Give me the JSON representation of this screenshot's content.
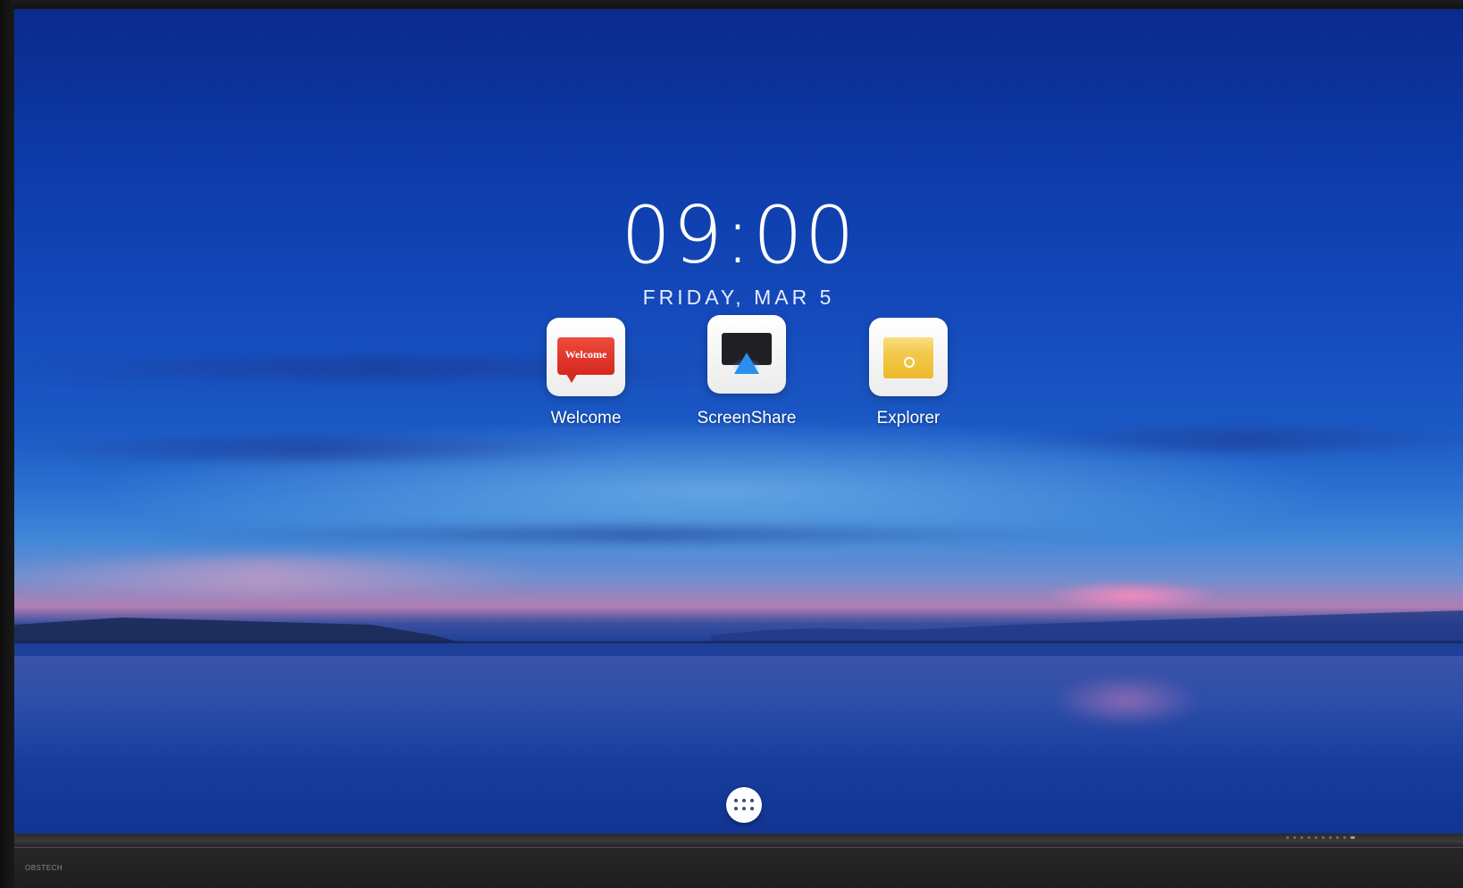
{
  "clock": {
    "time": "09:00",
    "date": "FRIDAY, MAR 5"
  },
  "apps": [
    {
      "label": "Welcome",
      "icon": "welcome-icon",
      "inner_text": "Welcome",
      "color": "#d5281f"
    },
    {
      "label": "ScreenShare",
      "icon": "screenshare-icon",
      "color": "#2b8ff0"
    },
    {
      "label": "Explorer",
      "icon": "folder-icon",
      "color": "#edb92a"
    }
  ],
  "drawer": {
    "icon": "app-drawer-icon"
  },
  "bezel": {
    "brand": "OBSTECH"
  }
}
